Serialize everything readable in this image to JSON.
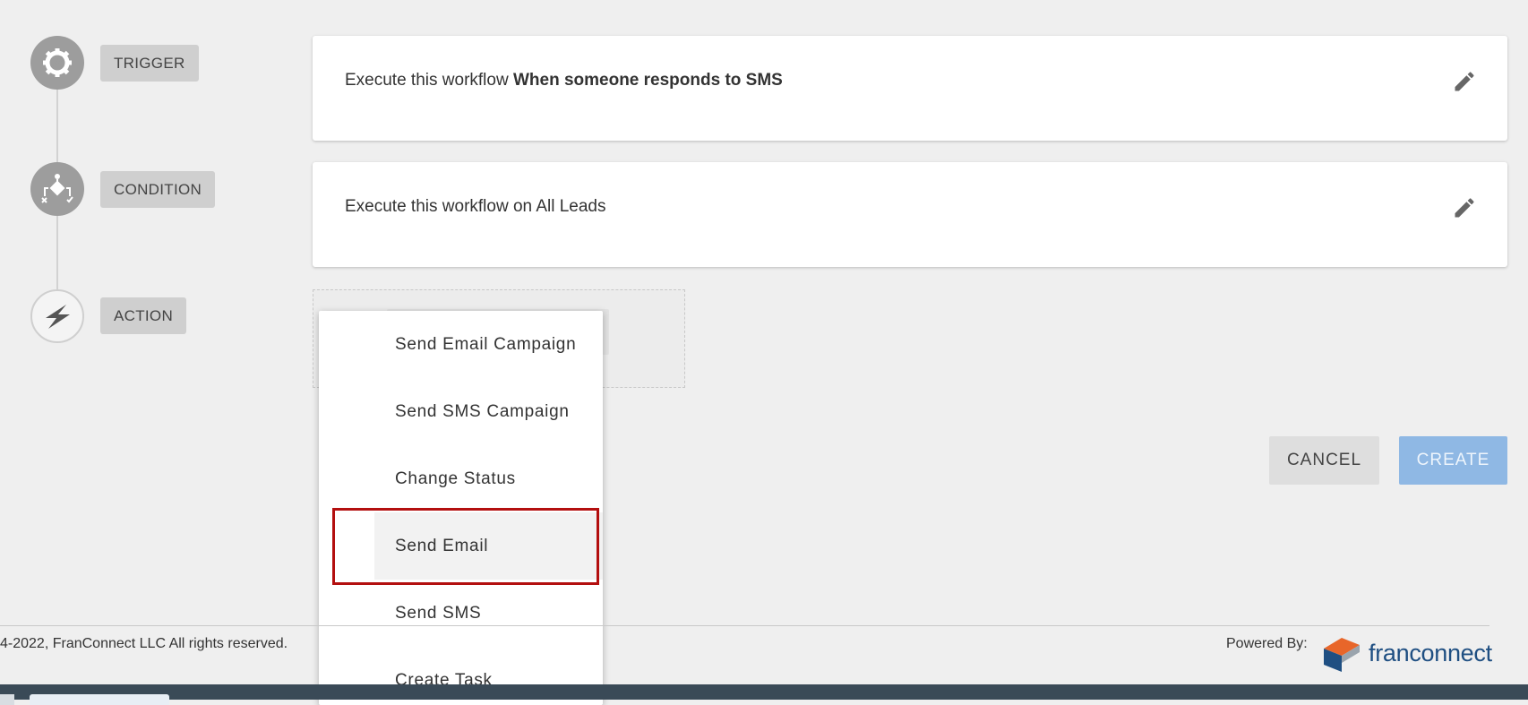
{
  "workflow": {
    "steps": [
      {
        "label": "TRIGGER",
        "icon": "gear-wrench-icon"
      },
      {
        "label": "CONDITION",
        "icon": "flow-branch-icon"
      },
      {
        "label": "ACTION",
        "icon": "lightning-icon"
      }
    ],
    "trigger_card": {
      "prefix": "Execute this workflow ",
      "bold": "When someone responds to SMS"
    },
    "condition_card": {
      "text": "Execute this workflow on All Leads"
    }
  },
  "action_menu": {
    "items": [
      "Send Email Campaign",
      "Send SMS Campaign",
      "Change Status",
      "Send Email",
      "Send SMS",
      "Create Task"
    ],
    "highlighted": "Send Email"
  },
  "buttons": {
    "cancel": "CANCEL",
    "create": "CREATE"
  },
  "footer": {
    "copyright": "4-2022, FranConnect LLC All rights reserved.",
    "powered_by": "Powered By:",
    "logo_text": "franconnect"
  },
  "colors": {
    "accent": "#8fb8e4",
    "highlight": "#b30f0f",
    "logo_blue": "#1f4f82",
    "logo_orange": "#e8662a"
  }
}
